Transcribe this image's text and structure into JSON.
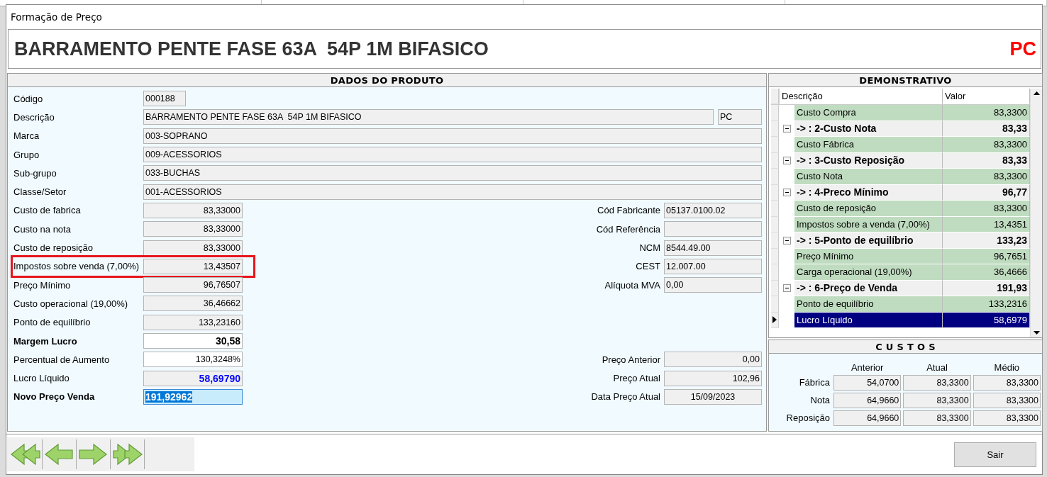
{
  "window": {
    "title": "Formação de Preço"
  },
  "product_header": {
    "title": "BARRAMENTO PENTE FASE 63A  54P 1M BIFASICO",
    "unit": "PC"
  },
  "dados_produto": {
    "title": "DADOS DO PRODUTO",
    "rows": [
      {
        "label": "Código",
        "value": "000188",
        "kind": "code",
        "emphasis": false,
        "highlighted": false
      },
      {
        "label": "Descrição",
        "value": "BARRAMENTO PENTE FASE 63A  54P 1M BIFASICO",
        "unit": "PC",
        "kind": "text",
        "emphasis": false,
        "highlighted": false
      },
      {
        "label": "Marca",
        "value": "003-SOPRANO",
        "kind": "text",
        "emphasis": false,
        "highlighted": false
      },
      {
        "label": "Grupo",
        "value": "009-ACESSORIOS",
        "kind": "text",
        "emphasis": false,
        "highlighted": false
      },
      {
        "label": "Sub-grupo",
        "value": "033-BUCHAS",
        "kind": "text",
        "emphasis": false,
        "highlighted": false
      },
      {
        "label": "Classe/Setor",
        "value": "001-ACESSORIOS",
        "kind": "text",
        "emphasis": false,
        "highlighted": false
      },
      {
        "label": "Custo de fabrica",
        "value": "83,33000",
        "kind": "number",
        "emphasis": false,
        "highlighted": false,
        "right": {
          "label": "Cód Fabricante",
          "value": "05137.0100.02",
          "kind": "text"
        }
      },
      {
        "label": "Custo na nota",
        "value": "83,33000",
        "kind": "number",
        "emphasis": false,
        "highlighted": false,
        "right": {
          "label": "Cód Referência",
          "kind": "text"
        }
      },
      {
        "label": "Custo de reposição",
        "value": "83,33000",
        "kind": "number",
        "emphasis": false,
        "highlighted": false,
        "right": {
          "label": "NCM",
          "value": "8544.49.00",
          "kind": "text"
        }
      },
      {
        "label": "Impostos sobre venda (7,00%)",
        "value": "13,43507",
        "kind": "number",
        "emphasis": false,
        "highlighted": true,
        "right": {
          "label": "CEST",
          "value": "12.007.00",
          "kind": "text"
        }
      },
      {
        "label": "Preço Mínimo",
        "value": "96,76507",
        "kind": "number",
        "emphasis": false,
        "highlighted": false,
        "right": {
          "label": "Alíquota MVA",
          "value": "0,00",
          "kind": "text"
        }
      },
      {
        "label": "Custo operacional (19,00%)",
        "value": "36,46662",
        "kind": "number",
        "emphasis": false,
        "highlighted": false
      },
      {
        "label": "Ponto de equilíbrio",
        "value": "133,23160",
        "kind": "number",
        "emphasis": false,
        "highlighted": false
      },
      {
        "label": "Margem Lucro",
        "value": "30,58",
        "kind": "input-bold",
        "emphasis": true,
        "highlighted": false
      },
      {
        "label": "Percentual de Aumento",
        "value": "130,3248%",
        "kind": "input",
        "emphasis": false,
        "highlighted": false,
        "right": {
          "label": "Preço Anterior",
          "value": "0,00",
          "kind": "number"
        }
      },
      {
        "label": "Lucro Líquido",
        "value": "58,69790",
        "kind": "profit",
        "emphasis": false,
        "highlighted": false,
        "right": {
          "label": "Preço Atual",
          "value": "102,96",
          "kind": "number"
        }
      },
      {
        "label": "Novo Preço Venda",
        "value": "191,92962",
        "kind": "selected-input",
        "emphasis": true,
        "highlighted": false,
        "right": {
          "label": "Data Preço Atual",
          "value": "15/09/2023",
          "kind": "date"
        }
      }
    ]
  },
  "demonstrativo": {
    "title": "DEMONSTRATIVO",
    "columns": [
      "Descrição",
      "Valor"
    ],
    "rows": [
      {
        "kind": "item",
        "label": "Custo Compra",
        "value": "83,3300",
        "selected": false
      },
      {
        "kind": "group",
        "label": "-> : 2-Custo Nota",
        "value": "83,33",
        "expanded": true,
        "children": [
          {
            "kind": "item",
            "label": "Custo Fábrica",
            "value": "83,3300",
            "selected": false
          }
        ]
      },
      {
        "kind": "group",
        "label": "-> : 3-Custo Reposição",
        "value": "83,33",
        "expanded": true,
        "children": [
          {
            "kind": "item",
            "label": "Custo Nota",
            "value": "83,3300",
            "selected": false
          }
        ]
      },
      {
        "kind": "group",
        "label": "-> : 4-Preco Mínimo",
        "value": "96,77",
        "expanded": true,
        "children": [
          {
            "kind": "item",
            "label": "Custo de reposição",
            "value": "83,3300",
            "selected": false
          },
          {
            "kind": "item",
            "label": "Impostos sobre a venda (7,00%)",
            "value": "13,4351",
            "selected": false
          }
        ]
      },
      {
        "kind": "group",
        "label": "-> : 5-Ponto de equilíbrio",
        "value": "133,23",
        "expanded": true,
        "children": [
          {
            "kind": "item",
            "label": "Preço Mínimo",
            "value": "96,7651",
            "selected": false
          },
          {
            "kind": "item",
            "label": "Carga operacional (19,00%)",
            "value": "36,4666",
            "selected": false
          }
        ]
      },
      {
        "kind": "group",
        "label": "-> : 6-Preço de Venda",
        "value": "191,93",
        "expanded": true,
        "children": [
          {
            "kind": "item",
            "label": "Ponto de equilíbrio",
            "value": "133,2316",
            "selected": false
          },
          {
            "kind": "item",
            "label": "Lucro Líquido",
            "value": "58,6979",
            "selected": true
          }
        ]
      }
    ]
  },
  "custos": {
    "title": "C U S T O S",
    "columns": [
      "Anterior",
      "Atual",
      "Médio"
    ],
    "rows": [
      {
        "label": "Fábrica",
        "values": [
          "54,0700",
          "83,3300",
          "83,3300"
        ]
      },
      {
        "label": "Nota",
        "values": [
          "64,9660",
          "83,3300",
          "83,3300"
        ]
      },
      {
        "label": "Reposição",
        "values": [
          "64,9660",
          "83,3300",
          "83,3300"
        ]
      }
    ]
  },
  "navigation": [
    {
      "kind": "first"
    },
    {
      "kind": "previous"
    },
    {
      "kind": "next"
    },
    {
      "kind": "last"
    }
  ],
  "buttons": [
    "Sair"
  ]
}
